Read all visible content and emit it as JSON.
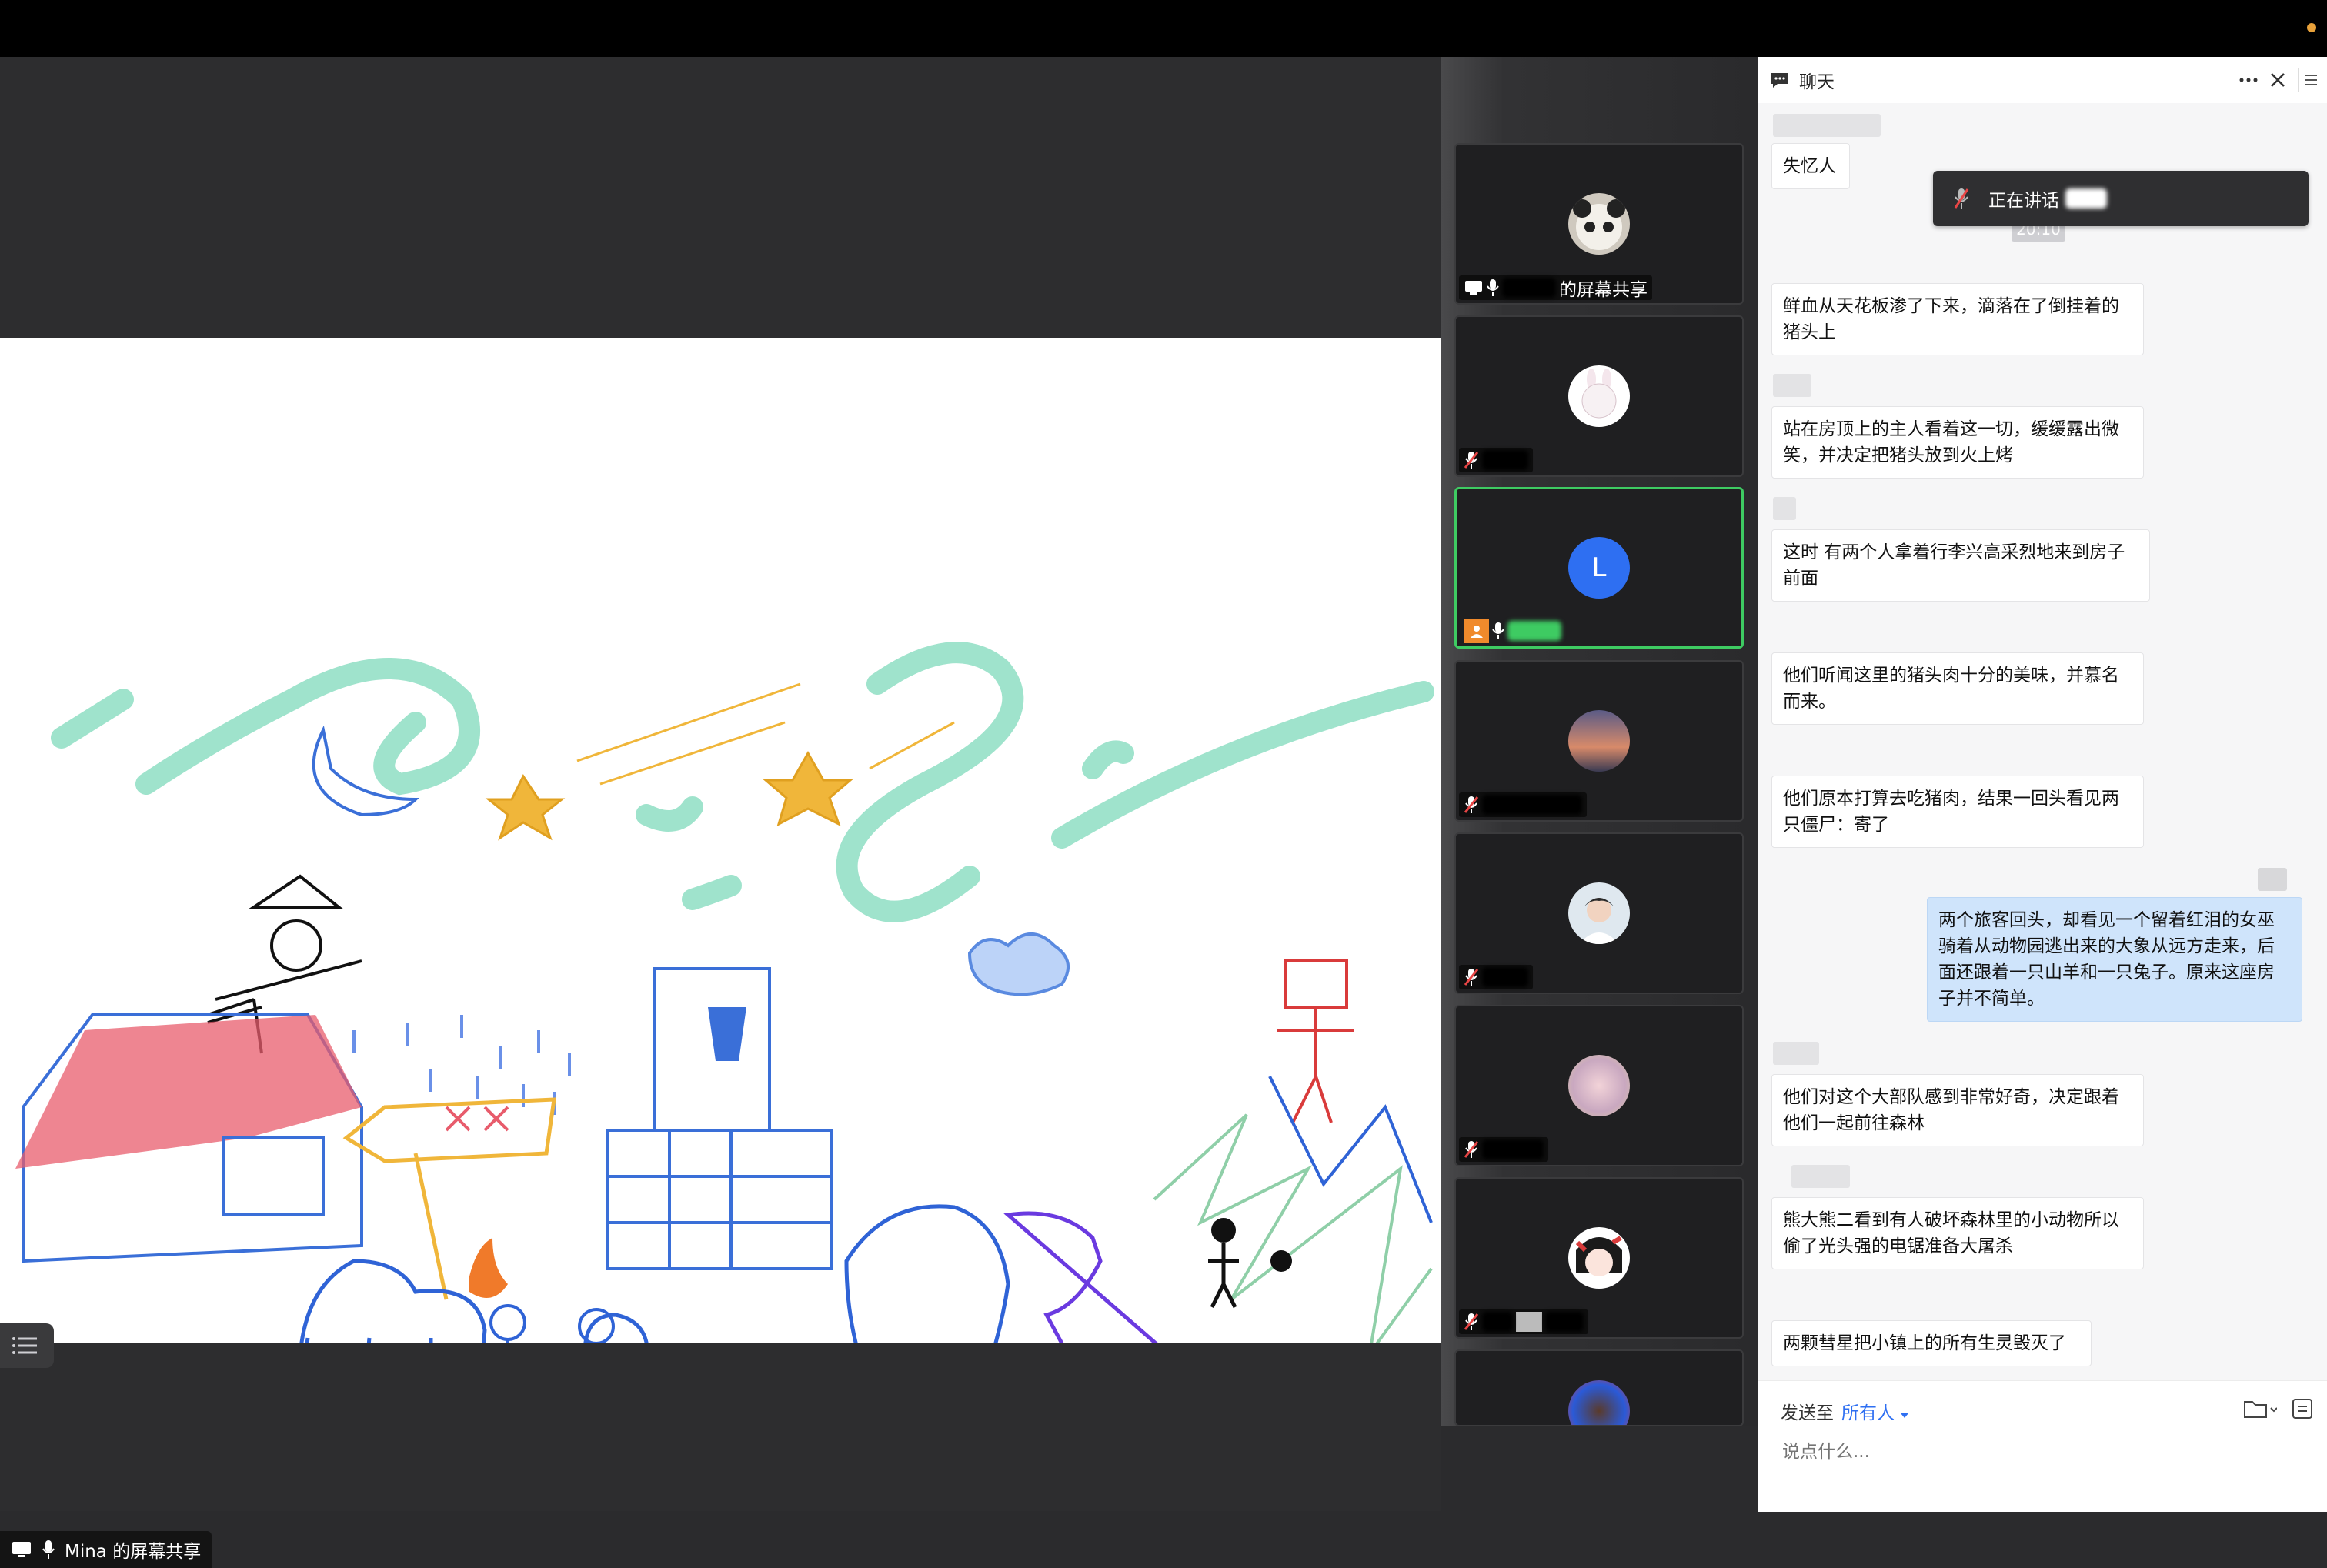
{
  "stage": {
    "share_label": "Mina 的屏幕共享"
  },
  "participants": {
    "share_tag": "的屏幕共享",
    "tiles": [
      {
        "avatar": "panda-photo",
        "muted": false,
        "label": "的屏幕共享"
      },
      {
        "avatar": "bunny-cartoon",
        "muted": true,
        "label": ""
      },
      {
        "avatar": "L",
        "muted": false,
        "label": "",
        "active": true
      },
      {
        "avatar": "sunset-photo",
        "muted": true,
        "label": ""
      },
      {
        "avatar": "girl-photo",
        "muted": true,
        "label": ""
      },
      {
        "avatar": "flower-photo",
        "muted": true,
        "label": ""
      },
      {
        "avatar": "anime-girl",
        "muted": true,
        "label": ""
      },
      {
        "avatar": "colorful-avatar",
        "muted": false,
        "label": ""
      }
    ]
  },
  "chat": {
    "title": "聊天",
    "speaking_label": "正在讲话",
    "timestamp": "20:10",
    "first_sender_label": "失忆人",
    "messages": [
      {
        "text": "鲜血从天花板渗了下来，滴落在了倒挂着的猪头上",
        "me": false
      },
      {
        "text": "站在房顶上的主人看着这一切，缓缓露出微笑，并决定把猪头放到火上烤",
        "me": false
      },
      {
        "text": "这时 有两个人拿着行李兴高采烈地来到房子前面",
        "me": false
      },
      {
        "text": "他们听闻这里的猪头肉十分的美味，并慕名而来。",
        "me": false
      },
      {
        "text": "他们原本打算去吃猪肉，结果一回头看见两只僵尸：寄了",
        "me": false
      },
      {
        "text": "两个旅客回头，却看见一个留着红泪的女巫骑着从动物园逃出来的大象从远方走来，后面还跟着一只山羊和一只兔子。原来这座房子并不简单。",
        "me": true
      },
      {
        "text": "他们对这个大部队感到非常好奇，决定跟着他们一起前往森林",
        "me": false
      },
      {
        "text": "熊大熊二看到有人破坏森林里的小动物所以偷了光头强的电锯准备大屠杀",
        "me": false
      },
      {
        "text": "两颗彗星把小镇上的所有生灵毁灭了",
        "me": false
      }
    ],
    "send_to_label": "发送至",
    "send_to_value": "所有人",
    "input_placeholder": "说点什么...",
    "colors": {
      "accent": "#2e6ff2",
      "active_border": "#3ecb62",
      "bubble_me": "#cfe4fb"
    }
  }
}
